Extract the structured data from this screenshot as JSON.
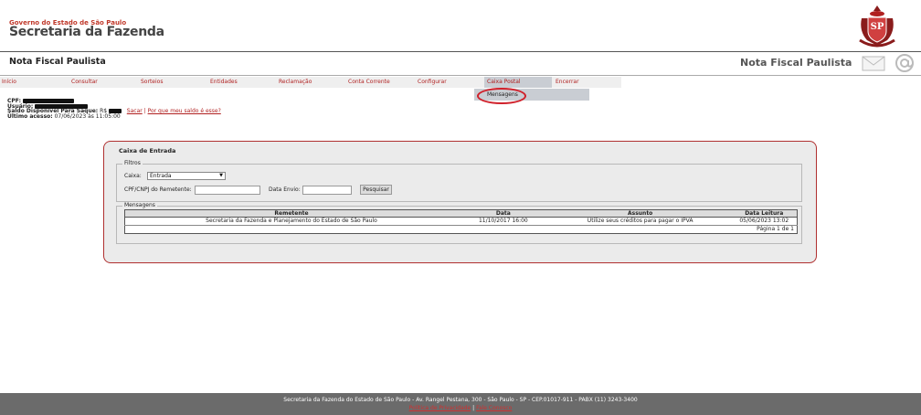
{
  "header": {
    "gov_line1": "Governo do Estado de São Paulo",
    "gov_line2": "Secretaria da Fazenda",
    "app_title_left": "Nota Fiscal Paulista",
    "app_title_right": "Nota Fiscal Paulista",
    "icons": [
      "brasao-sp-icon",
      "mail-icon",
      "at-sign-icon"
    ],
    "brasao_text": "SP"
  },
  "menu": {
    "items": [
      {
        "label": "Início"
      },
      {
        "label": "Consultar"
      },
      {
        "label": "Sorteios"
      },
      {
        "label": "Entidades"
      },
      {
        "label": "Reclamação"
      },
      {
        "label": "Conta Corrente"
      },
      {
        "label": "Configurar"
      },
      {
        "label": "Caixa Postal",
        "active": true
      },
      {
        "label": "Encerrar"
      }
    ],
    "submenu": {
      "label": "Mensagens"
    }
  },
  "user_info": {
    "cpf_label": "CPF:",
    "usuario_label": "Usuário:",
    "saldo_label": "Saldo Disponível Para Saque:",
    "saldo_prefix": "R$",
    "sacar_link": "Sacar",
    "separator": "|",
    "why_link": "Por que meu saldo é esse?",
    "ultimo_label": "Último acesso:",
    "ultimo_value": "07/06/2023 às 11:05:00"
  },
  "caixa": {
    "title": "Caixa de Entrada",
    "filtros_legend": "Filtros",
    "caixa_label": "Caixa:",
    "caixa_selected": "Entrada",
    "cpf_cnpj_label": "CPF/CNPJ do Remetente:",
    "data_envio_label": "Data Envio:",
    "pesquisar_label": "Pesquisar",
    "mensagens_legend": "Mensagens",
    "columns": [
      "Remetente",
      "Data",
      "Assunto",
      "Data Leitura"
    ],
    "rows": [
      [
        "Secretaria da Fazenda e Planejamento do Estado de São Paulo",
        "11/10/2017 16:00",
        "Utilize seus créditos para pagar o IPVA",
        "05/06/2023 13:02"
      ]
    ],
    "pager": "Página 1 de 1"
  },
  "footer": {
    "address": "Secretaria da Fazenda do Estado de São Paulo - Av. Rangel Pestana, 300 - São Paulo - SP - CEP.01017-911 - PABX (11) 3243-3400",
    "link1": "Política de Privacidade",
    "sep": "|",
    "link2": "Fale Conosco"
  },
  "colors": {
    "accent_red": "#b02020",
    "menu_active": "#c9cdd3",
    "footer_bg": "#6b6b6b",
    "panel_border": "#b03030"
  }
}
